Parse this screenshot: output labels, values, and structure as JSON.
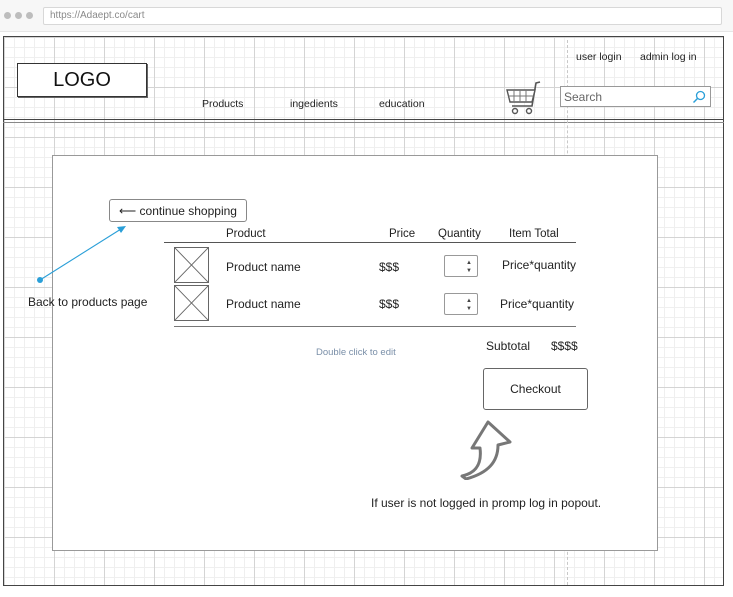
{
  "browser": {
    "url": "https://Adaept.co/cart"
  },
  "header": {
    "logo": "LOGO",
    "nav": [
      "Products",
      "ingedients",
      "education"
    ],
    "user_login": "user login",
    "admin_login": "admin log in",
    "search_placeholder": "Search"
  },
  "cart": {
    "continue_label": "⟵ continue shopping",
    "back_note": "Back to products page",
    "columns": [
      "Product",
      "Price",
      "Quantity",
      "Item Total"
    ],
    "rows": [
      {
        "name": "Product name",
        "price": "$$$",
        "total": "Price*quantity"
      },
      {
        "name": "Product name",
        "price": "$$$",
        "total": "Price*quantity"
      }
    ],
    "edit_hint": "Double click to edit",
    "subtotal_label": "Subtotal",
    "subtotal_value": "$$$$",
    "checkout_label": "Checkout",
    "login_note": "If user is not logged in promp log in popout."
  },
  "colors": {
    "link_arrow": "#2a9fd8",
    "hint_text": "#7a8fa8"
  }
}
